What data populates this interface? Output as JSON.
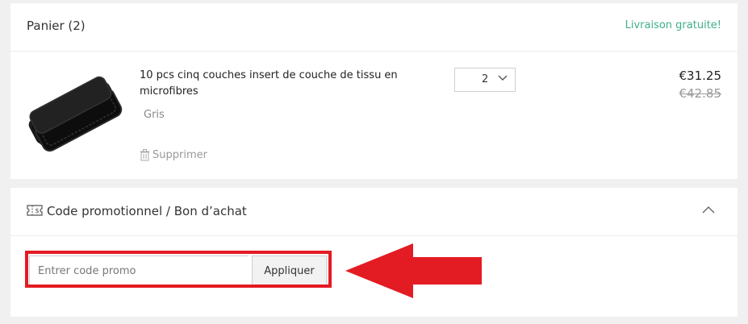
{
  "cart": {
    "title": "Panier (2)",
    "free_shipping": "Livraison gratuite!",
    "item": {
      "image_icon": "diaper-insert-product-photo",
      "title": "10 pcs cinq couches insert de couche de tissu en microfibres",
      "variant": "Gris",
      "delete_label": "Supprimer",
      "quantity": "2",
      "price_current": "€31.25",
      "price_old": "€42.85"
    }
  },
  "promo": {
    "title": "Code promotionnel / Bon d’achat",
    "input_placeholder": "Entrer code promo",
    "input_value": "",
    "apply_label": "Appliquer"
  },
  "annotation": {
    "color": "#e31b23"
  },
  "colors": {
    "accent_green": "#3fae8a",
    "annotation_red": "#e31b23"
  }
}
